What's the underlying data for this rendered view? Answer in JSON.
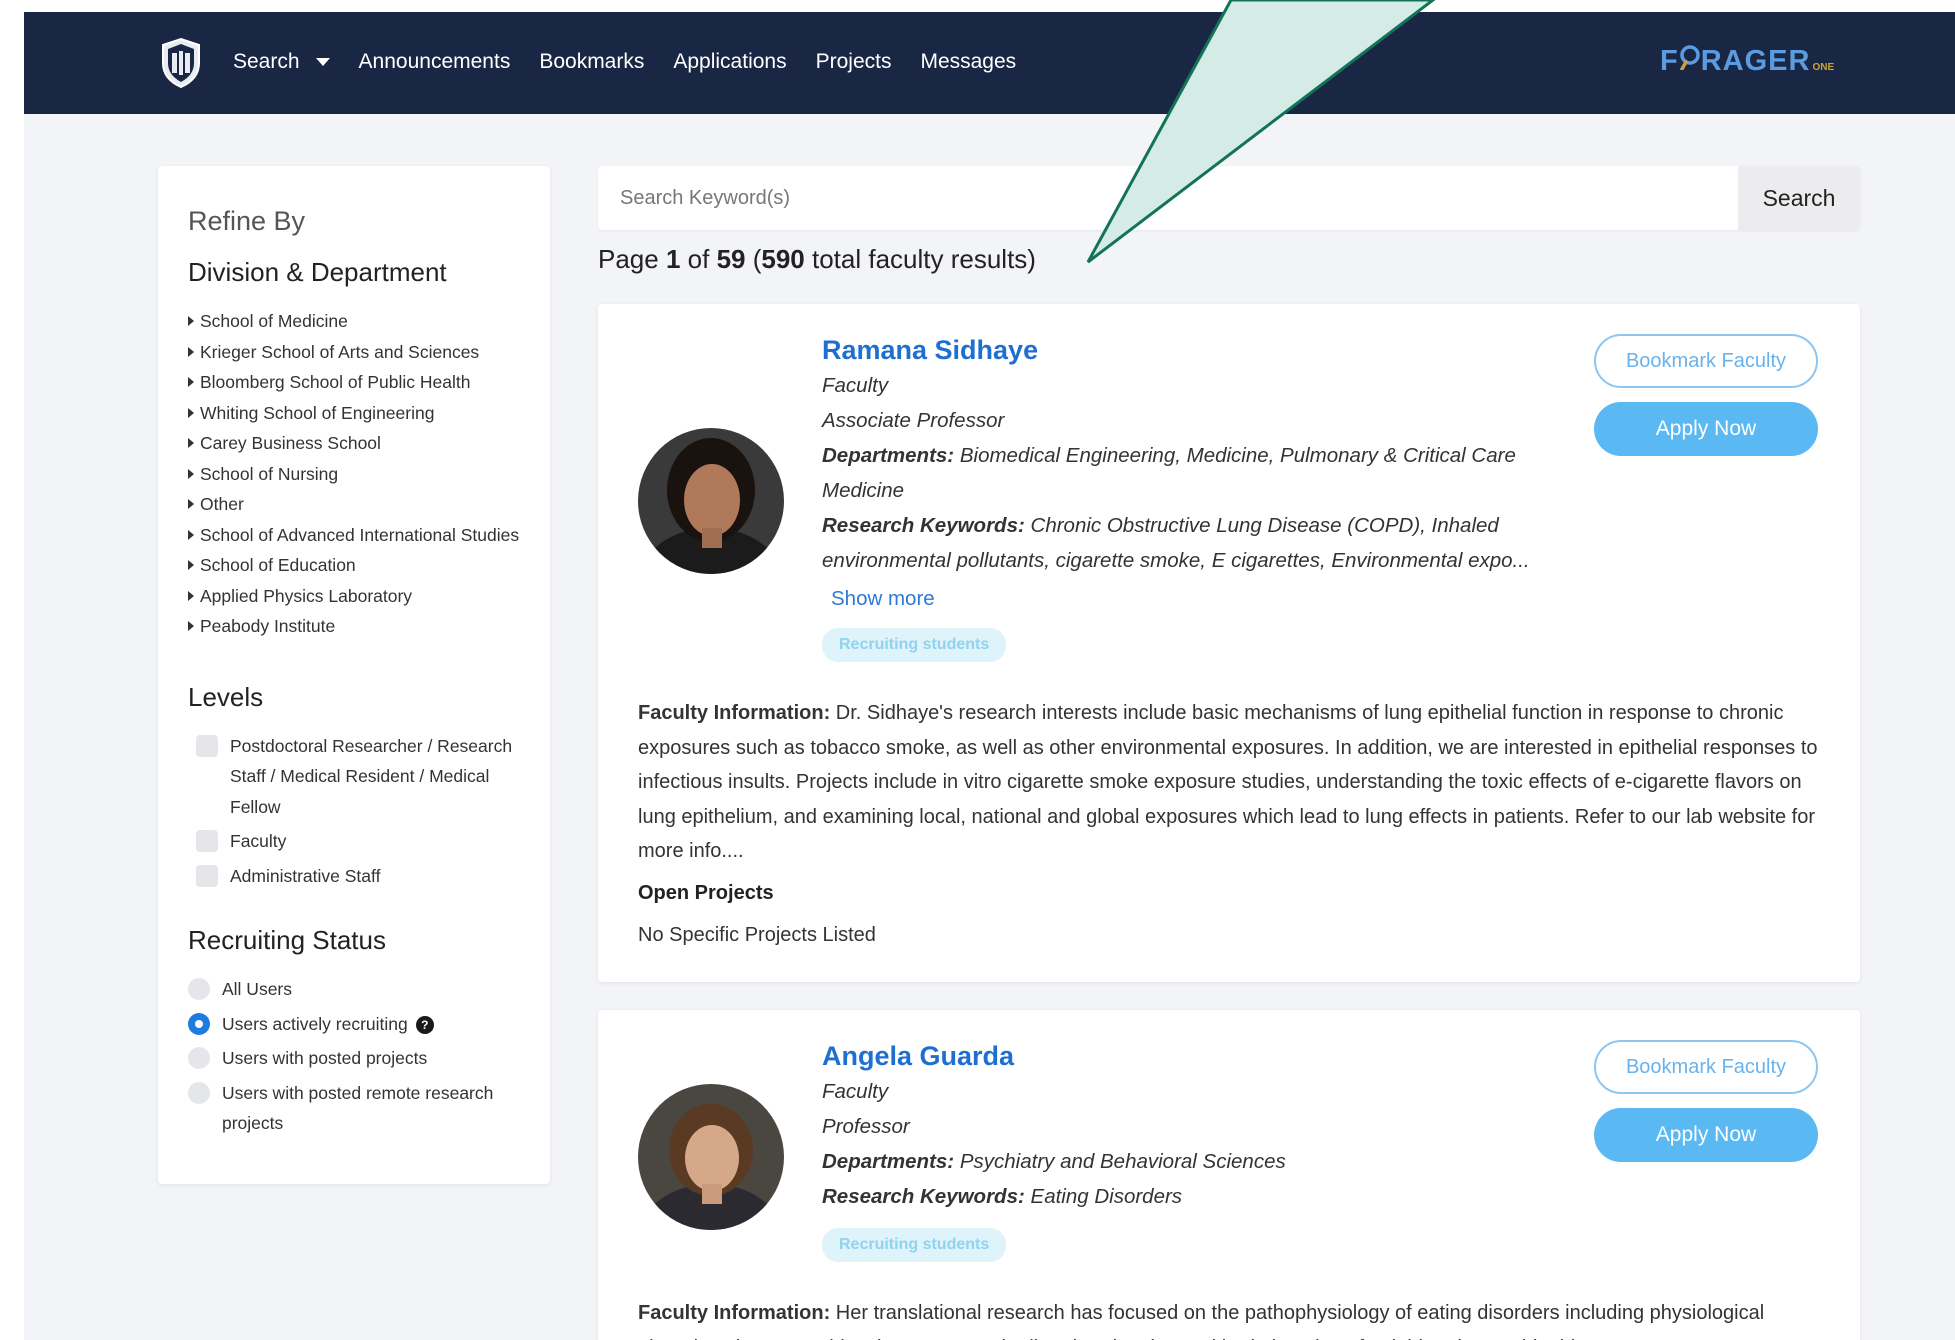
{
  "nav": {
    "links": [
      "Search",
      "Announcements",
      "Bookmarks",
      "Applications",
      "Projects",
      "Messages"
    ],
    "brand": "F  RAGER",
    "brand_lens": "O",
    "brand_suffix": "ONE"
  },
  "sidebar": {
    "refine_label": "Refine By",
    "division_heading": "Division & Department",
    "departments": [
      "School of Medicine",
      "Krieger School of Arts and Sciences",
      "Bloomberg School of Public Health",
      "Whiting School of Engineering",
      "Carey Business School",
      "School of Nursing",
      "Other",
      "School of Advanced International Studies",
      "School of Education",
      "Applied Physics Laboratory",
      "Peabody Institute"
    ],
    "levels_heading": "Levels",
    "levels": [
      "Postdoctoral Researcher / Research Staff / Medical Resident / Medical Fellow",
      "Faculty",
      "Administrative Staff"
    ],
    "recruiting_heading": "Recruiting Status",
    "recruiting_options": [
      {
        "label": "All Users",
        "selected": false
      },
      {
        "label": "Users actively recruiting",
        "selected": true,
        "help": "?"
      },
      {
        "label": "Users with posted projects",
        "selected": false
      },
      {
        "label": "Users with posted remote research projects",
        "selected": false
      }
    ]
  },
  "search": {
    "placeholder": "Search Keyword(s)",
    "button_label": "Search"
  },
  "pagination": {
    "prefix": "Page ",
    "current": "1",
    "of": " of ",
    "total_pages": "59",
    "open": " (",
    "total_results": "590",
    "suffix": " total faculty results)"
  },
  "results": [
    {
      "name": "Ramana Sidhaye",
      "role": "Faculty",
      "title": "Associate Professor",
      "departments_label": "Departments:",
      "departments": "Biomedical Engineering, Medicine, Pulmonary & Critical Care Medicine",
      "keywords_label": "Research Keywords:",
      "keywords": "Chronic Obstructive Lung Disease (COPD), Inhaled environmental pollutants, cigarette smoke, E cigarettes,  Environmental expo...",
      "show_more": "Show more",
      "badge": "Recruiting students",
      "bookmark_label": "Bookmark Faculty",
      "apply_label": "Apply Now",
      "info_label": "Faculty Information:",
      "info": "Dr. Sidhaye's research interests include basic mechanisms of lung epithelial function in response to chronic exposures such as tobacco smoke, as well as other environmental exposures. In addition, we are interested in epithelial responses to infectious insults. Projects include in vitro cigarette smoke exposure studies, understanding the toxic effects of e-cigarette flavors on lung epithelium, and examining local, national and global exposures which lead to lung effects in patients. Refer to our lab website for more info....",
      "open_projects_label": "Open Projects",
      "open_projects": "No Specific Projects Listed"
    },
    {
      "name": "Angela Guarda",
      "role": "Faculty",
      "title": "Professor",
      "departments_label": "Departments:",
      "departments": "Psychiatry and Behavioral Sciences",
      "keywords_label": "Research Keywords:",
      "keywords": "Eating Disorders",
      "badge": "Recruiting students",
      "bookmark_label": "Bookmark Faculty",
      "apply_label": "Apply Now",
      "info_label": "Faculty Information:",
      "info": "Her translational research has focused on the pathophysiology of eating disorders including physiological alterations in gut peptides that may sustain disordered eating and brain imaging of opioid and cannabinoid"
    }
  ],
  "colors": {
    "navbar": "#1a2744",
    "link": "#1f6fd1",
    "apply": "#5ab9f2",
    "annotation_fill": "#d5ebe6",
    "annotation_stroke": "#137358"
  }
}
